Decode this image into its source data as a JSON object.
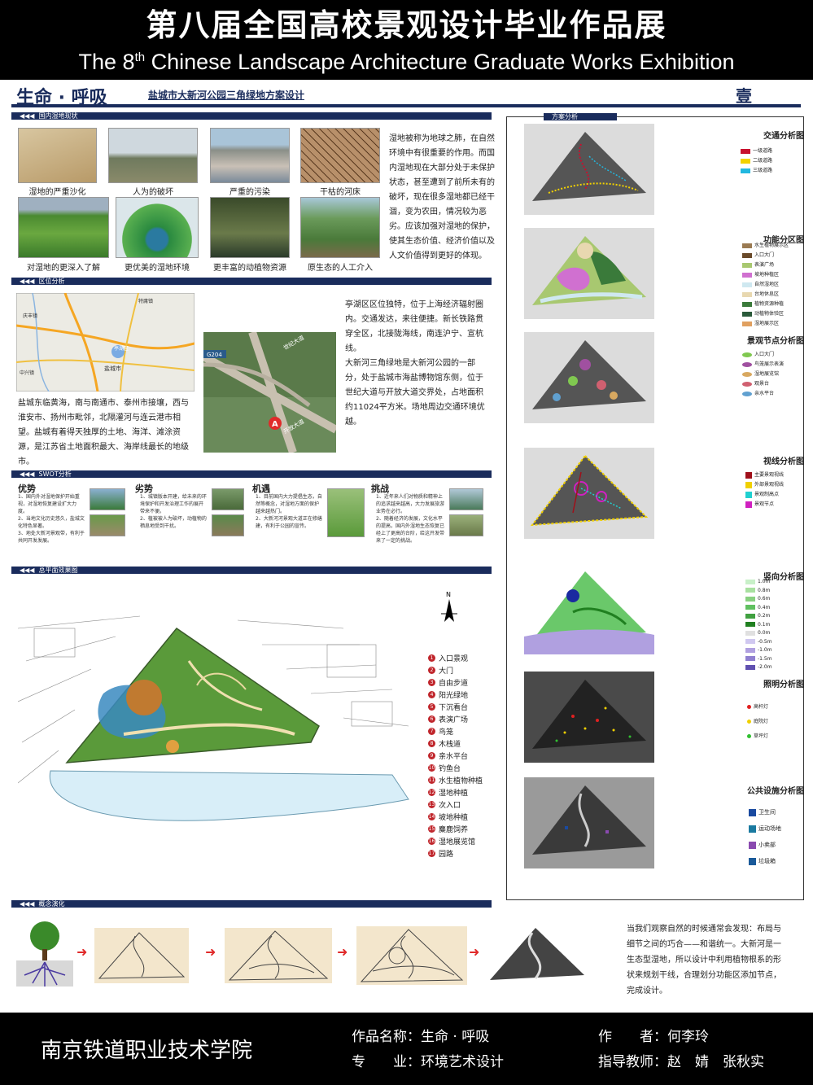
{
  "header": {
    "title_cn": "第八届全国高校景观设计毕业作品展",
    "title_en_prefix": "The 8",
    "title_en_sup": "th",
    "title_en_suffix": " Chinese Landscape Architecture Graduate Works Exhibition"
  },
  "banner": {
    "brand": "生命 · 呼吸",
    "subtitle": "盐城市大新河公园三角绿地方案设计",
    "sheet_no": "壹"
  },
  "sections": {
    "wetland": "国内湿地现状",
    "location": "区位分析",
    "swot": "SWOT分析",
    "masterplan": "总平面效果图",
    "concept": "概念演化",
    "analysis": "方案分析"
  },
  "wetland": {
    "captions": [
      "湿地的严重沙化",
      "人为的破坏",
      "严重的污染",
      "干枯的河床",
      "对湿地的更深入了解",
      "更优美的湿地环境",
      "更丰富的动植物资源",
      "原生态的人工介入"
    ],
    "text": "湿地被称为地球之肺，在自然环境中有很重要的作用。而国内湿地现在大部分处于未保护状态，甚至遭到了前所未有的破坏，现在很多湿地都已经干涸，变为农田，情况较为恶劣。应该加强对湿地的保护，使其生态价值、经济价值以及人文价值得到更好的体现。"
  },
  "location": {
    "text_left": "盐城东临黄海，南与南通市、泰州市接壤，西与淮安市、扬州市毗邻，北隔灌河与连云港市相望。盐城有着得天独厚的土地、海洋、滩涂资源，是江苏省土地面积最大、海岸线最长的地级市。",
    "text_right_1": "亭湖区区位独特，位于上海经济辐射圈内。交通发达，来往便捷。新长铁路贯穿全区，北接陇海线，南连沪宁、宣杭线。",
    "text_right_2": "大新河三角绿地是大新河公园的一部分，处于盐城市海盐博物馆东侧，位于世纪大道与开放大道交界处，占地面积约11024平方米。场地周边交通环境优越。",
    "map_labels": [
      "盐城市",
      "亭湖区",
      "特庸镇",
      "庆丰镇",
      "中兴镇",
      "G204",
      "世纪大道",
      "开放大道"
    ],
    "marker": "A"
  },
  "swot": [
    {
      "head": "优势",
      "body": "1、国内外对湿地保护开始重视，对湿地恢复建设扩大力度。\n2、当地文化历史悠久，盐城文化特色显著。\n3、地处大新河景观带，有利于共同开发发展。"
    },
    {
      "head": "劣势",
      "body": "1、城镇版本开建，给未来的环境保护和开发治理工作的展开带来不便。\n2、植被被人为破坏，动植物的栖息地受到干扰。"
    },
    {
      "head": "机遇",
      "body": "1、目前国内大力提倡生态，自然等概念，对湿地方面的保护越来越热门。\n2、大新河河景观大道正在修缮建，有利于公园的宣传。"
    },
    {
      "head": "挑战",
      "body": "1、近年来人们对物质和精神上的追求越来越高，大力发展旅游业势在必行。\n2、随着经济的发展，文化水平的提高，国内外湿地生态恢复已经上了更高的台阶，给这开发带来了一定的挑战。"
    }
  ],
  "masterplan": {
    "legend": [
      {
        "n": "1",
        "label": "入口景观"
      },
      {
        "n": "2",
        "label": "大门"
      },
      {
        "n": "3",
        "label": "自由步道"
      },
      {
        "n": "4",
        "label": "阳光绿地"
      },
      {
        "n": "5",
        "label": "下沉看台"
      },
      {
        "n": "6",
        "label": "表演广场"
      },
      {
        "n": "7",
        "label": "鸟笼"
      },
      {
        "n": "8",
        "label": "木栈道"
      },
      {
        "n": "9",
        "label": "亲水平台"
      },
      {
        "n": "10",
        "label": "钓鱼台"
      },
      {
        "n": "11",
        "label": "水生植物种植"
      },
      {
        "n": "12",
        "label": "湿地种植"
      },
      {
        "n": "13",
        "label": "次入口"
      },
      {
        "n": "14",
        "label": "坡地种植"
      },
      {
        "n": "15",
        "label": "麋鹿饲养"
      },
      {
        "n": "16",
        "label": "湿地展览馆"
      },
      {
        "n": "17",
        "label": "园路"
      }
    ],
    "north": "N"
  },
  "analysis": [
    {
      "title": "交通分析图",
      "legend": [
        {
          "label": "一级道路",
          "color": "#c8102e"
        },
        {
          "label": "二级道路",
          "color": "#f2d200"
        },
        {
          "label": "三级道路",
          "color": "#22b8e0"
        }
      ]
    },
    {
      "title": "功能分区图",
      "legend": [
        {
          "label": "水生植物展示区",
          "color": "#9a7a52"
        },
        {
          "label": "入口大门",
          "color": "#6a4a2a"
        },
        {
          "label": "表演广场",
          "color": "#a8c870"
        },
        {
          "label": "坡地种植区",
          "color": "#d070d0"
        },
        {
          "label": "自然湿地区",
          "color": "#cfe8f0"
        },
        {
          "label": "台地休息区",
          "color": "#e8d8b0"
        },
        {
          "label": "植物资源种植",
          "color": "#3a7a3a"
        },
        {
          "label": "动植物体验区",
          "color": "#2a5a3a"
        },
        {
          "label": "湿地展示区",
          "color": "#e0a060"
        }
      ]
    },
    {
      "title": "景观节点分析图",
      "legend": [
        {
          "label": "入口大门",
          "color": "#80c850"
        },
        {
          "label": "鸟笼展示表演",
          "color": "#a050a0"
        },
        {
          "label": "湿地展览馆",
          "color": "#d8a860"
        },
        {
          "label": "观景台",
          "color": "#d06070"
        },
        {
          "label": "亲水平台",
          "color": "#60a0d0"
        }
      ]
    },
    {
      "title": "视线分析图",
      "legend": [
        {
          "label": "主要景观视线",
          "color": "#a0101a"
        },
        {
          "label": "外部景观视线",
          "color": "#f0d000"
        },
        {
          "label": "景观制高点",
          "color": "#20d0d0"
        },
        {
          "label": "景观节点",
          "color": "#d020c0"
        }
      ]
    },
    {
      "title": "竖向分析图",
      "legend": [
        {
          "label": "1.0m",
          "color": "#c8f0c8"
        },
        {
          "label": "0.8m",
          "color": "#a8e0a0"
        },
        {
          "label": "0.6m",
          "color": "#88d080"
        },
        {
          "label": "0.4m",
          "color": "#60c060"
        },
        {
          "label": "0.2m",
          "color": "#40a040"
        },
        {
          "label": "0.1m",
          "color": "#208020"
        },
        {
          "label": "0.0m",
          "color": "#e0e0e0"
        },
        {
          "label": "-0.5m",
          "color": "#d0c8f0"
        },
        {
          "label": "-1.0m",
          "color": "#b0a0e0"
        },
        {
          "label": "-1.5m",
          "color": "#9080d0"
        },
        {
          "label": "-2.0m",
          "color": "#6050b0"
        }
      ]
    },
    {
      "title": "照明分析图",
      "legend": [
        {
          "label": "高杆灯",
          "color": "#e02020"
        },
        {
          "label": "庭院灯",
          "color": "#f0d000"
        },
        {
          "label": "草坪灯",
          "color": "#30c030"
        }
      ]
    },
    {
      "title": "公共设施分析图",
      "legend": [
        {
          "label": "卫生间",
          "color": "#1a4aa0"
        },
        {
          "label": "运动场地",
          "color": "#1a7aa0"
        },
        {
          "label": "小卖部",
          "color": "#8a4ab0"
        },
        {
          "label": "垃圾箱",
          "color": "#1a5a9a"
        }
      ]
    }
  ],
  "concept": {
    "text": "当我们观察自然的时候通常会发现：布局与细节之间的巧合——和谐统一。大新河是一生态型湿地，所以设计中利用植物根系的形状来规划干线，合理划分功能区添加节点，完成设计。"
  },
  "footer": {
    "school": "南京铁道职业技术学院",
    "work_label": "作品名称：",
    "work_value": "生命 · 呼吸",
    "author_label": "作　　者：",
    "author_value": "何李玲",
    "major_label": "专　　业：",
    "major_value": "环境艺术设计",
    "teacher_label": "指导教师：",
    "teacher_value": "赵　婧　张秋实"
  }
}
